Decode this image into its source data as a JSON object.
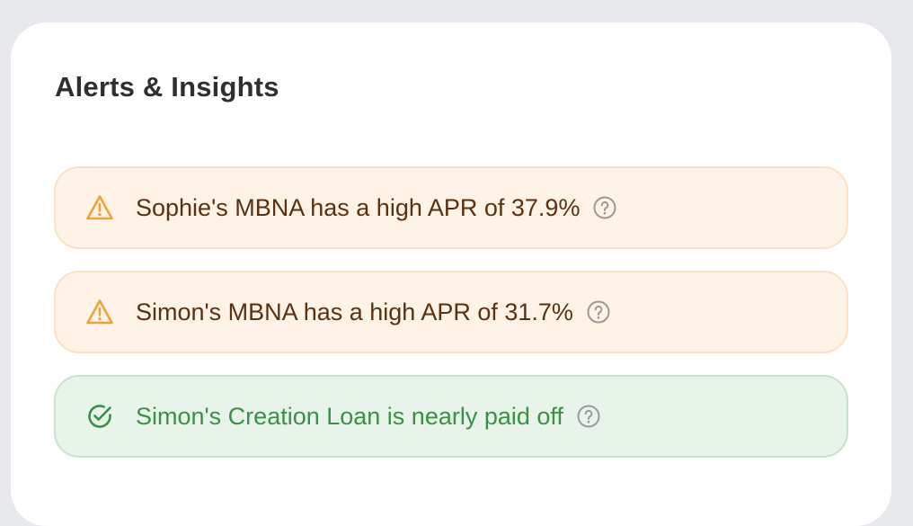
{
  "panel": {
    "title": "Alerts & Insights"
  },
  "alerts": [
    {
      "type": "warning",
      "icon": "warning-triangle-icon",
      "text": "Sophie's MBNA has a high APR of 37.9%",
      "help_icon": "help-circle-icon"
    },
    {
      "type": "warning",
      "icon": "warning-triangle-icon",
      "text": "Simon's MBNA has a high APR of 31.7%",
      "help_icon": "help-circle-icon"
    },
    {
      "type": "success",
      "icon": "check-circle-icon",
      "text": "Simon's Creation Loan is nearly paid off",
      "help_icon": "help-circle-icon"
    }
  ],
  "colors": {
    "warning_bg": "#fef3e6",
    "warning_border": "#fbe1c1",
    "warning_icon": "#f0a23a",
    "warning_text": "#5b3010",
    "success_bg": "#e8f3ea",
    "success_border": "#c8e2cd",
    "success_text": "#3a9144",
    "help_icon": "#9a9a9a"
  }
}
